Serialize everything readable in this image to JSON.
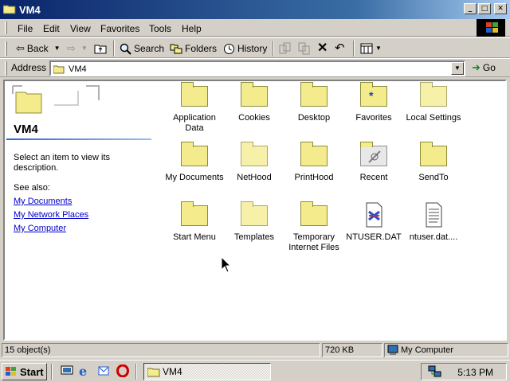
{
  "window": {
    "title": "VM4"
  },
  "title_buttons": {
    "minimize": "_",
    "maximize": "□",
    "close": "✕"
  },
  "menu": [
    "File",
    "Edit",
    "View",
    "Favorites",
    "Tools",
    "Help"
  ],
  "toolbar": {
    "back": "Back",
    "search": "Search",
    "folders": "Folders",
    "history": "History"
  },
  "address": {
    "label": "Address",
    "value": "VM4",
    "go": "Go"
  },
  "left_pane": {
    "title": "VM4",
    "description": "Select an item to view its description.",
    "see_also": "See also:",
    "links": [
      "My Documents",
      "My Network Places",
      "My Computer"
    ]
  },
  "items": [
    {
      "label": "Application Data",
      "icon": "folder-icon"
    },
    {
      "label": "Cookies",
      "icon": "folder-icon"
    },
    {
      "label": "Desktop",
      "icon": "folder-icon"
    },
    {
      "label": "Favorites",
      "icon": "favorites-folder-icon"
    },
    {
      "label": "Local Settings",
      "icon": "folder-icon"
    },
    {
      "label": "My Documents",
      "icon": "folder-icon"
    },
    {
      "label": "NetHood",
      "icon": "folder-icon"
    },
    {
      "label": "PrintHood",
      "icon": "folder-icon"
    },
    {
      "label": "Recent",
      "icon": "recent-folder-icon"
    },
    {
      "label": "SendTo",
      "icon": "folder-icon"
    },
    {
      "label": "Start Menu",
      "icon": "folder-icon"
    },
    {
      "label": "Templates",
      "icon": "folder-icon"
    },
    {
      "label": "Temporary Internet Files",
      "icon": "folder-icon"
    },
    {
      "label": "NTUSER.DAT",
      "icon": "registry-file-icon"
    },
    {
      "label": "ntuser.dat....",
      "icon": "text-file-icon"
    }
  ],
  "status": {
    "objects": "15 object(s)",
    "size": "720 KB",
    "zone": "My Computer"
  },
  "taskbar": {
    "start": "Start",
    "task": "VM4",
    "clock": "5:13 PM"
  }
}
